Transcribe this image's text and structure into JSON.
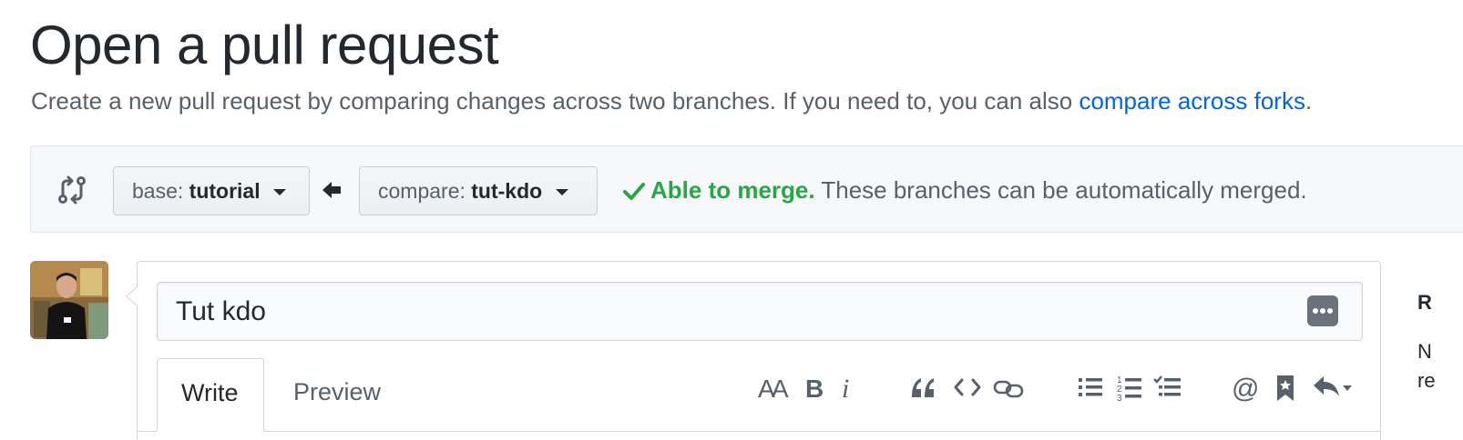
{
  "header": {
    "title": "Open a pull request",
    "subtitle": "Create a new pull request by comparing changes across two branches. If you need to, you can also ",
    "subtitle_link": "compare across forks",
    "subtitle_end": "."
  },
  "range": {
    "base_prefix": "base:",
    "base_branch": "tutorial",
    "compare_prefix": "compare:",
    "compare_branch": "tut-kdo",
    "merge_status": "Able to merge.",
    "merge_message": " These branches can be automatically merged."
  },
  "form": {
    "title_value": "Tut kdo",
    "tabs": [
      {
        "label": "Write"
      },
      {
        "label": "Preview"
      }
    ]
  },
  "toolbar": {
    "icons": [
      "text-size-icon",
      "bold-icon",
      "italic-icon",
      "quote-icon",
      "code-icon",
      "link-icon",
      "unordered-list-icon",
      "ordered-list-icon",
      "task-list-icon",
      "mention-icon",
      "reference-icon",
      "reply-icon"
    ]
  },
  "sidebar": {
    "fragment_1": "R",
    "fragment_2": "N",
    "fragment_3": "re"
  },
  "colors": {
    "link": "#0366d6",
    "success": "#28a745",
    "muted": "#586069",
    "border": "#d1d5da"
  }
}
